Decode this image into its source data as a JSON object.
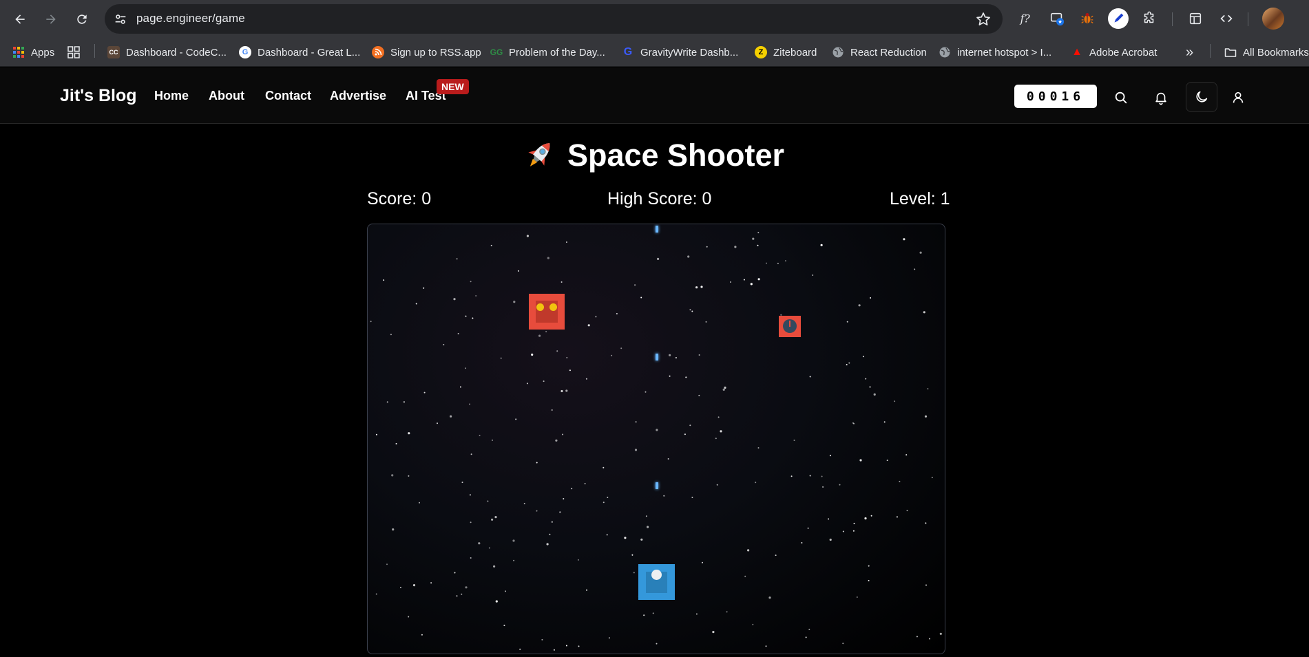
{
  "browser": {
    "url": "page.engineer/game",
    "bookmarks": [
      {
        "label": "Apps",
        "icon": "apps-grid-icon"
      },
      {
        "label": "",
        "icon": "tab-groups-icon"
      },
      {
        "label": "Dashboard - CodeC...",
        "icon": "codechef-icon"
      },
      {
        "label": "Dashboard - Great L...",
        "icon": "google-icon"
      },
      {
        "label": "Sign up to RSS.app",
        "icon": "rss-icon"
      },
      {
        "label": "Problem of the Day...",
        "icon": "geeksforgeeks-icon"
      },
      {
        "label": "GravityWrite Dashb...",
        "icon": "gravitywrite-icon"
      },
      {
        "label": "Ziteboard",
        "icon": "ziteboard-icon"
      },
      {
        "label": "React Reduction",
        "icon": "globe-icon"
      },
      {
        "label": "internet hotspot > I...",
        "icon": "globe-icon"
      },
      {
        "label": "Adobe Acrobat",
        "icon": "adobe-icon"
      }
    ],
    "all_bookmarks": "All Bookmarks",
    "overflow": "»"
  },
  "site": {
    "brand": "Jit's Blog",
    "nav": [
      "Home",
      "About",
      "Contact",
      "Advertise",
      "AI Test"
    ],
    "badge": "NEW",
    "counter": "00016"
  },
  "game": {
    "title": "Space Shooter",
    "score_label": "Score: 0",
    "high_score_label": "High Score: 0",
    "level_label": "Level: 1",
    "score": 0,
    "high_score": 0,
    "level": 1,
    "colors": {
      "enemy": "#e74c3c",
      "enemy_core": "#c0392b",
      "player": "#3498db",
      "bullet": "#6ab7ff",
      "enemy_eye": "#f1c40f"
    }
  }
}
